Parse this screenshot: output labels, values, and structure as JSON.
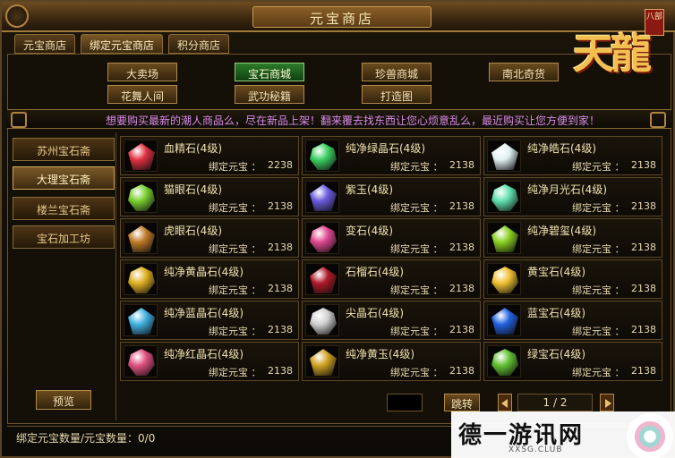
{
  "window": {
    "title": "元宝商店"
  },
  "tabs": [
    {
      "label": "元宝商店"
    },
    {
      "label": "绑定元宝商店"
    },
    {
      "label": "积分商店"
    }
  ],
  "categories": [
    {
      "label": "大卖场"
    },
    {
      "label": "宝石商城"
    },
    {
      "label": "珍兽商城"
    },
    {
      "label": "南北奇货"
    },
    {
      "label": "花舞人间"
    },
    {
      "label": "武功秘籍"
    },
    {
      "label": "打造图"
    }
  ],
  "banner": "想要购买最新的潮人商品么，尽在新品上架！翻来覆去找东西让您心烦意乱么，最近购买让您方便到家！",
  "shops": [
    {
      "label": "苏州宝石斋"
    },
    {
      "label": "大理宝石斋"
    },
    {
      "label": "楼兰宝石斋"
    },
    {
      "label": "宝石加工坊"
    }
  ],
  "preview_label": "预览",
  "price_label": "绑定元宝 ：",
  "items": [
    {
      "name": "血精石(4级)",
      "price": "2238",
      "icon": "red-gem-icon",
      "color": "#e03040"
    },
    {
      "name": "纯净绿晶石(4级)",
      "price": "2138",
      "icon": "green-crystal-icon",
      "color": "#3ad060"
    },
    {
      "name": "纯净皓石(4级)",
      "price": "2138",
      "icon": "white-gem-icon",
      "color": "#e0f0f0"
    },
    {
      "name": "猫眼石(4级)",
      "price": "2138",
      "icon": "green-cateye-icon",
      "color": "#7ad030"
    },
    {
      "name": "紫玉(4级)",
      "price": "2138",
      "icon": "purple-jade-icon",
      "color": "#6a5ae0"
    },
    {
      "name": "纯净月光石(4级)",
      "price": "2138",
      "icon": "moonstone-icon",
      "color": "#60e0b0"
    },
    {
      "name": "虎眼石(4级)",
      "price": "2138",
      "icon": "tiger-eye-icon",
      "color": "#c07a28"
    },
    {
      "name": "变石(4级)",
      "price": "2138",
      "icon": "alexandrite-icon",
      "color": "#e04890"
    },
    {
      "name": "纯净碧玺(4级)",
      "price": "2138",
      "icon": "tourmaline-icon",
      "color": "#8ad020"
    },
    {
      "name": "纯净黄晶石(4级)",
      "price": "2138",
      "icon": "yellow-crystal-icon",
      "color": "#e0b020"
    },
    {
      "name": "石榴石(4级)",
      "price": "2138",
      "icon": "garnet-icon",
      "color": "#b01828"
    },
    {
      "name": "黄宝石(4级)",
      "price": "2138",
      "icon": "topaz-icon",
      "color": "#f0c030"
    },
    {
      "name": "纯净蓝晶石(4级)",
      "price": "2138",
      "icon": "blue-crystal-icon",
      "color": "#40b0e0"
    },
    {
      "name": "尖晶石(4级)",
      "price": "2138",
      "icon": "spinel-icon",
      "color": "#d0d0d0"
    },
    {
      "name": "蓝宝石(4级)",
      "price": "2138",
      "icon": "sapphire-icon",
      "color": "#2060e0"
    },
    {
      "name": "纯净红晶石(4级)",
      "price": "2138",
      "icon": "red-crystal-icon",
      "color": "#e05080"
    },
    {
      "name": "纯净黄玉(4级)",
      "price": "2138",
      "icon": "yellow-jade-icon",
      "color": "#d0a020"
    },
    {
      "name": "绿宝石(4级)",
      "price": "2138",
      "icon": "emerald-icon",
      "color": "#60c030"
    }
  ],
  "pager": {
    "jump_label": "跳转",
    "page": "1 / 2"
  },
  "footer": {
    "quantity": "绑定元宝数量/元宝数量：0/0"
  },
  "logo": {
    "text": "天龍",
    "badge": "八部"
  },
  "watermark": {
    "text": "德一游讯网",
    "domain": "XXSG.CLUB"
  }
}
